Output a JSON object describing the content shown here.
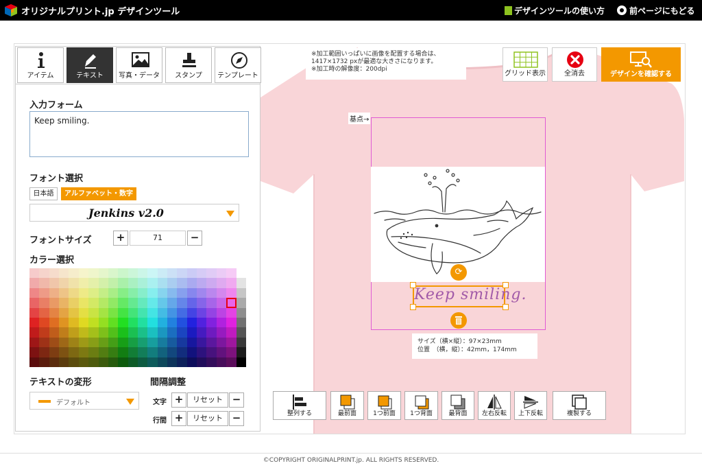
{
  "header": {
    "title": "オリジナルプリント.jp デザインツール",
    "guide_link": "デザインツールの使い方",
    "back_link": "前ページにもどる"
  },
  "tabs": [
    {
      "label": "アイテム",
      "icon": "info-icon",
      "active": false
    },
    {
      "label": "テキスト",
      "icon": "pen-icon",
      "active": true
    },
    {
      "label": "写真・データ",
      "icon": "photo-icon",
      "active": false
    },
    {
      "label": "スタンプ",
      "icon": "stamp-icon",
      "active": false
    },
    {
      "label": "テンプレート",
      "icon": "compass-icon",
      "active": false
    }
  ],
  "text_panel": {
    "input_label": "入力フォーム",
    "input_value": "Keep smiling.",
    "font_label": "フォント選択",
    "lang_japanese": "日本語",
    "lang_alpha": "アルファベット・数字",
    "font_value": "Jenkins v2.0",
    "size_label": "フォントサイズ",
    "size_value": "71",
    "color_label": "カラー選択",
    "transform_label": "テキストの変形",
    "transform_value": "デフォルト",
    "spacing_label": "間隔調整",
    "char_label": "文字",
    "line_label": "行間",
    "reset_label": "リセット"
  },
  "canvas": {
    "notice_lines": [
      "※加工範囲いっぱいに画像を配置する場合は、",
      "1417×1732 pxが最適な大きさになります。",
      "※加工時の解像度：200dpi"
    ],
    "grid_label": "グリッド表示",
    "clear_label": "全消去",
    "confirm_label": "デザインを確認する",
    "origin_label": "基点→",
    "text_object": "Keep smiling.",
    "size_info": "サイズ（横×縦）：97×23mm",
    "position_info": "位置　（横，縦）：42mm，174mm",
    "shirt_color": "#f9d5d8"
  },
  "layer_buttons": [
    "整列する",
    "最前面",
    "1つ前面",
    "1つ背面",
    "最背面",
    "左右反転",
    "上下反転",
    "複製する"
  ],
  "footer": {
    "copyright": "©COPYRIGHT ORIGINALPRINT.jp. ALL RIGHTS RESERVED."
  },
  "colors": {
    "accent": "#f39800",
    "selected_color": "#e60012"
  }
}
